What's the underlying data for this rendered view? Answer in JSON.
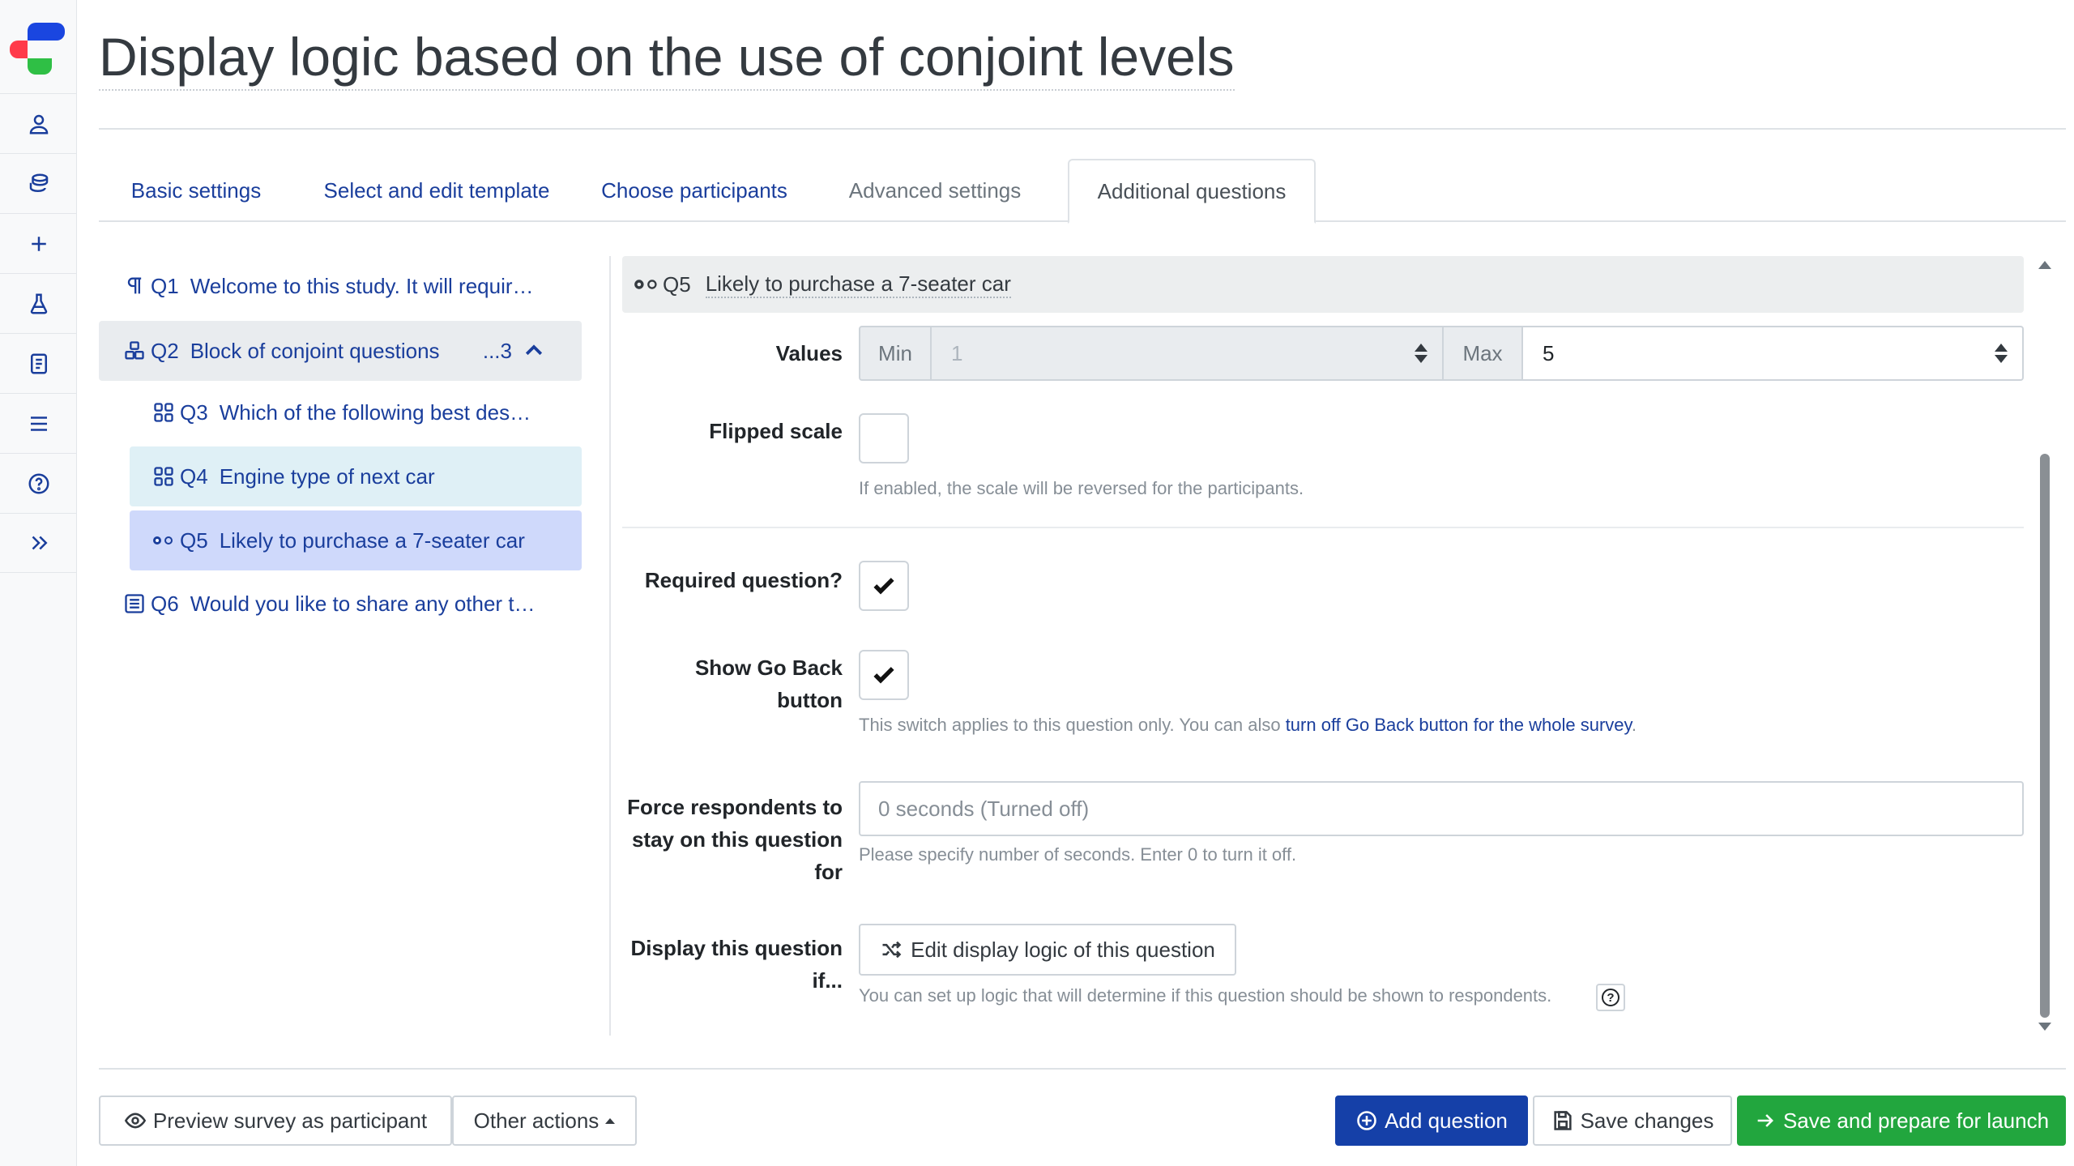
{
  "page": {
    "title": "Display logic based on the use of conjoint levels"
  },
  "rail": {
    "items": [
      "user-icon",
      "database-icon",
      "plus-icon",
      "flask-icon",
      "notebook-icon",
      "menu-icon",
      "help-icon",
      "expand-icon"
    ]
  },
  "tabs": [
    {
      "label": "Basic settings"
    },
    {
      "label": "Select and edit template"
    },
    {
      "label": "Choose participants"
    },
    {
      "label": "Advanced settings"
    },
    {
      "label": "Additional questions"
    }
  ],
  "tree": {
    "items": [
      {
        "num": "Q1",
        "label": "Welcome to this study. It will requir…",
        "icon": "paragraph-icon"
      },
      {
        "num": "Q2",
        "label": "Block of conjoint questions",
        "count": "...3",
        "icon": "blocks-icon"
      },
      {
        "num": "Q3",
        "label": "Which of the following best des…",
        "icon": "grid-icon"
      },
      {
        "num": "Q4",
        "label": "Engine type of next car",
        "icon": "grid-icon"
      },
      {
        "num": "Q5",
        "label": "Likely to purchase a 7-seater car",
        "icon": "scale-icon"
      },
      {
        "num": "Q6",
        "label": "Would you like to share any other t…",
        "icon": "text-icon"
      }
    ]
  },
  "editor": {
    "header": {
      "num": "Q5",
      "label": "Likely to purchase a 7-seater car"
    },
    "values": {
      "label": "Values",
      "min_label": "Min",
      "min_value": "1",
      "max_label": "Max",
      "max_value": "5"
    },
    "flipped": {
      "label": "Flipped scale",
      "help": "If enabled, the scale will be reversed for the participants.",
      "checked": false
    },
    "required": {
      "label": "Required question?",
      "checked": true
    },
    "goback": {
      "label_1": "Show Go Back",
      "label_2": "button",
      "checked": true,
      "help": "This switch applies to this question only. You can also ",
      "help_link": "turn off Go Back button for the whole survey",
      "help_end": "."
    },
    "force": {
      "label_1": "Force respondents to",
      "label_2": "stay on this question",
      "label_3": "for",
      "placeholder": "0 seconds (Turned off)",
      "help": "Please specify number of seconds. Enter 0 to turn it off."
    },
    "display": {
      "label_1": "Display this question",
      "label_2": "if...",
      "button": "Edit display logic of this question",
      "help": "You can set up logic that will determine if this question should be shown to respondents."
    }
  },
  "footer": {
    "preview": "Preview survey as participant",
    "other": "Other actions",
    "add": "Add question",
    "save": "Save changes",
    "launch": "Save and prepare for launch"
  },
  "colors": {
    "primary": "#1540a8",
    "success": "#22a63e",
    "link": "#1a3e9c"
  }
}
